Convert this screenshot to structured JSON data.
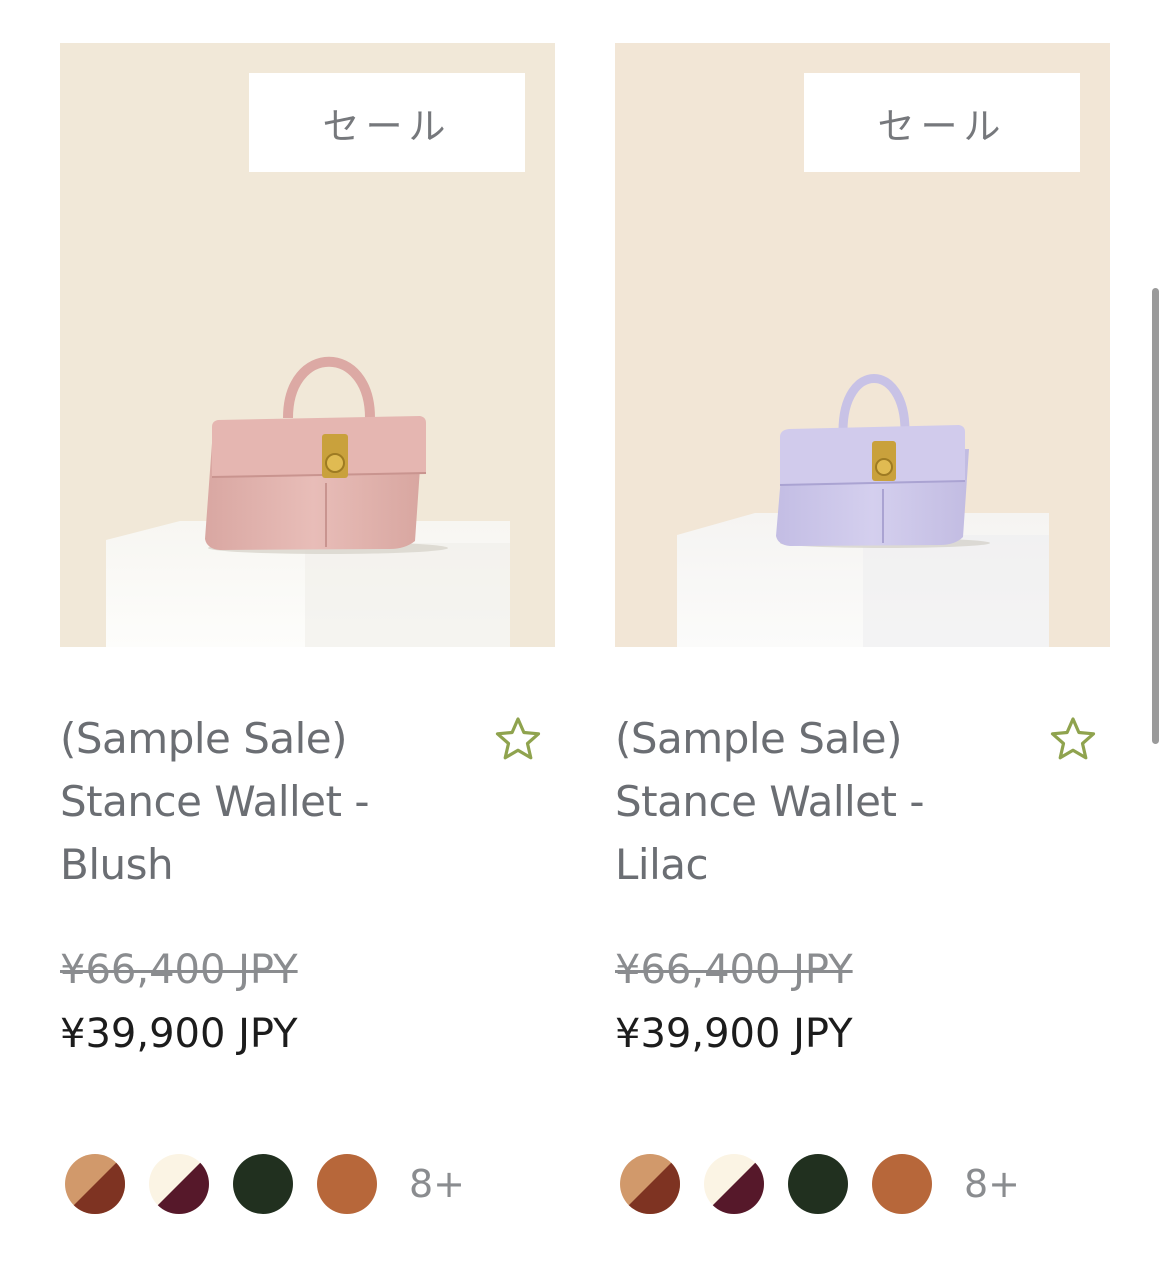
{
  "products": [
    {
      "badge": "セール",
      "title_lines": [
        "(Sample Sale)",
        "Stance Wallet -",
        "Blush"
      ],
      "price_original": "¥66,400 JPY",
      "price_sale": "¥39,900 JPY",
      "swatch_more": "8+",
      "bag_color": "#e6b9b4",
      "background_color": "#f1e8d8"
    },
    {
      "badge": "セール",
      "title_lines": [
        "(Sample Sale)",
        "Stance Wallet -",
        "Lilac"
      ],
      "price_original": "¥66,400 JPY",
      "price_sale": "¥39,900 JPY",
      "swatch_more": "8+",
      "bag_color": "#cfc9ea",
      "background_color": "#f2e6d6"
    }
  ],
  "swatch_colors": [
    {
      "name": "tan-chestnut",
      "a": "#d1996b",
      "b": "#7e3322"
    },
    {
      "name": "cream-burgundy",
      "a": "#fbf4e4",
      "b": "#56182a"
    },
    {
      "name": "forest-green",
      "a": "#21301f",
      "b": "#21301f"
    },
    {
      "name": "cognac",
      "a": "#b7673a",
      "b": "#b7673a"
    }
  ],
  "icons": {
    "favorite": "star-outline-icon",
    "favorite_color": "#8fa34e"
  }
}
